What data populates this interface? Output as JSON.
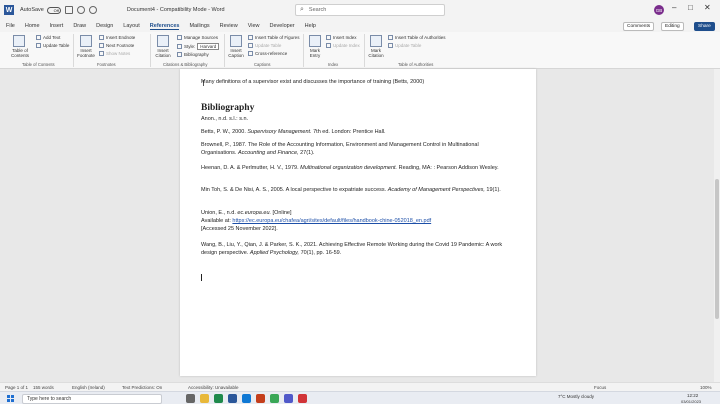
{
  "titlebar": {
    "autosave_label": "AutoSave",
    "autosave_state": "Off",
    "document_title": "Document4 - Compatibility Mode - Word",
    "search_placeholder": "Search",
    "avatar_initials": "GB"
  },
  "menu": {
    "items": [
      "File",
      "Home",
      "Insert",
      "Draw",
      "Design",
      "Layout",
      "References",
      "Mailings",
      "Review",
      "View",
      "Developer",
      "Help"
    ],
    "active": "References",
    "comments_label": "Comments",
    "editing_label": "Editing",
    "share_label": "Share"
  },
  "ribbon": {
    "toc": {
      "table_of_contents": "Table of Contents",
      "add_text": "Add Text",
      "update_table": "Update Table",
      "group": "Table of Contents"
    },
    "footnotes": {
      "insert_footnote": "Insert Footnote",
      "insert_endnote": "Insert Endnote",
      "next_footnote": "Next Footnote",
      "show_notes": "Show Notes",
      "group": "Footnotes"
    },
    "citations": {
      "insert_citation": "Insert Citation",
      "manage_sources": "Manage Sources",
      "style_label": "Style:",
      "style_value": "Harvard",
      "bibliography": "Bibliography",
      "group": "Citations & Bibliography"
    },
    "captions": {
      "insert_caption": "Insert Caption",
      "insert_table_of_figures": "Insert Table of Figures",
      "update_table": "Update Table",
      "cross_reference": "Cross-reference",
      "group": "Captions"
    },
    "index": {
      "mark_entry": "Mark Entry",
      "insert_index": "Insert Index",
      "update_index": "Update Index",
      "group": "Index"
    },
    "authorities": {
      "mark_citation": "Mark Citation",
      "insert_table_of_authorities": "Insert Table of Authorities",
      "update_table": "Update Table",
      "group": "Table of Authorities"
    }
  },
  "document": {
    "intro_text": "Many definitions of a supervisor exist and discusses the importance of training (Betts, 2000)",
    "bibliography_heading": "Bibliography",
    "references": [
      {
        "parts": [
          "Anon., n.d. s.l.: s.n."
        ]
      },
      {
        "parts": [
          "Betts, P. W., 2000. ",
          "Supervisory Management.",
          " 7th ed. London: Prentice Hall."
        ]
      },
      {
        "parts": [
          "Brownell, P., 1987. The Role of the Accounting Information, Environment and Management Control in Multinational Organisations. ",
          "Accounting and Finance,",
          " 27(1)."
        ]
      },
      {
        "parts": [
          "Heenan, D. A. & Perlmutter, H. V., 1979. ",
          "Multinational organization development.",
          " Reading, MA: : Pearson Addison Wesley."
        ]
      },
      {
        "parts": [
          "Min Toh, S. & De Nisi, A. S., 2005. A local perspective to expatriate success. ",
          "Academy of Management Perspectives,",
          " 19(1)."
        ]
      },
      {
        "parts": [
          "Union, E., n.d. ",
          "ec.europa.eu.",
          " [Online]"
        ],
        "available_label": "Available at: ",
        "url": "https://ec.europa.eu/chafea/agri/sites/default/files/handbook-chine-052018_en.pdf",
        "accessed": "[Accessed 25 November 2022]."
      },
      {
        "parts": [
          "Wang, B., Liu, Y., Qian, J. & Parker, S. K., 2021. Achieving Effective Remote Working during the Covid 19 Pandemic: A work design perspective. ",
          "Applied Psychology,",
          " 70(1), pp. 16-59."
        ]
      }
    ]
  },
  "statusbar": {
    "page": "Page 1 of 1",
    "words": "155 words",
    "language": "English (Ireland)",
    "text_predictions": "Text Predictions: On",
    "accessibility": "Accessibility: Unavailable",
    "focus": "Focus",
    "zoom": "100%"
  },
  "taskbar": {
    "search_placeholder": "Type here to search",
    "weather": "7°C  Mostly cloudy",
    "time": "12:22",
    "date": "03/01/2023"
  }
}
